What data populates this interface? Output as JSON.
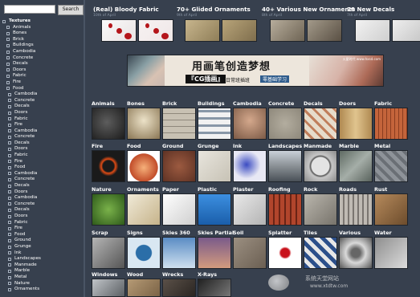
{
  "search": {
    "value": "",
    "button_label": "Search"
  },
  "tree": [
    {
      "label": "Textures",
      "level": 0,
      "root": true
    },
    {
      "label": "Animals",
      "level": 1
    },
    {
      "label": "Bones",
      "level": 1
    },
    {
      "label": "Brick",
      "level": 1
    },
    {
      "label": "Buildings",
      "level": 1
    },
    {
      "label": "Cambodia",
      "level": 1
    },
    {
      "label": "Concrete",
      "level": 1
    },
    {
      "label": "Decals",
      "level": 1
    },
    {
      "label": "Doors",
      "level": 1
    },
    {
      "label": "Fabric",
      "level": 1
    },
    {
      "label": "Fire",
      "level": 1
    },
    {
      "label": "Food",
      "level": 1
    },
    {
      "label": "Cambodia",
      "level": 2
    },
    {
      "label": "Concrete",
      "level": 2
    },
    {
      "label": "Decals",
      "level": 2
    },
    {
      "label": "Doors",
      "level": 2
    },
    {
      "label": "Fabric",
      "level": 2
    },
    {
      "label": "Fire",
      "level": 2
    },
    {
      "label": "Cambodia",
      "level": 2
    },
    {
      "label": "Concrete",
      "level": 2
    },
    {
      "label": "Decals",
      "level": 2
    },
    {
      "label": "Doors",
      "level": 2
    },
    {
      "label": "Fabric",
      "level": 2
    },
    {
      "label": "Fire",
      "level": 2
    },
    {
      "label": "Food",
      "level": 2
    },
    {
      "label": "Cambodia",
      "level": 2
    },
    {
      "label": "Concrete",
      "level": 2
    },
    {
      "label": "Decals",
      "level": 2
    },
    {
      "label": "Doors",
      "level": 2
    },
    {
      "label": "Cambodia",
      "level": 2
    },
    {
      "label": "Concrete",
      "level": 2
    },
    {
      "label": "Decals",
      "level": 2
    },
    {
      "label": "Doors",
      "level": 2
    },
    {
      "label": "Fabric",
      "level": 2
    },
    {
      "label": "Fire",
      "level": 2
    },
    {
      "label": "Food",
      "level": 2
    },
    {
      "label": "Ground",
      "level": 2
    },
    {
      "label": "Grunge",
      "level": 2
    },
    {
      "label": "Ink",
      "level": 2
    },
    {
      "label": "Landscapes",
      "level": 2
    },
    {
      "label": "Manmade",
      "level": 2
    },
    {
      "label": "Marble",
      "level": 2
    },
    {
      "label": "Metal",
      "level": 2
    },
    {
      "label": "Nature",
      "level": 2
    },
    {
      "label": "Ornaments",
      "level": 2
    }
  ],
  "top_cards": [
    {
      "title": "(Real) Bloody Fabric",
      "date": "10th of April"
    },
    {
      "title": "70+ Glided Ornaments",
      "date": "9th of April"
    },
    {
      "title": "40+ Various New Ornaments",
      "date": "8th of April"
    },
    {
      "title": "20 New Decals",
      "date": "7th of April"
    }
  ],
  "banner": {
    "title": "用画笔创造梦想",
    "brand": "『CG插画』",
    "tagline": "日常班插班",
    "button": "零基础学习",
    "corner_text": "火星时代 www.hxsd.com"
  },
  "categories": [
    {
      "label": "Animals"
    },
    {
      "label": "Bones"
    },
    {
      "label": "Brick"
    },
    {
      "label": "Buildings"
    },
    {
      "label": "Cambodia"
    },
    {
      "label": "Concrete"
    },
    {
      "label": "Decals"
    },
    {
      "label": "Doors"
    },
    {
      "label": "Fabric"
    },
    {
      "label": "Fire"
    },
    {
      "label": "Food"
    },
    {
      "label": "Ground"
    },
    {
      "label": "Grunge"
    },
    {
      "label": "Ink"
    },
    {
      "label": "Landscapes"
    },
    {
      "label": "Manmade"
    },
    {
      "label": "Marble"
    },
    {
      "label": "Metal"
    },
    {
      "label": "Nature"
    },
    {
      "label": "Ornaments"
    },
    {
      "label": "Paper"
    },
    {
      "label": "Plastic"
    },
    {
      "label": "Plaster"
    },
    {
      "label": "Roofing"
    },
    {
      "label": "Rock"
    },
    {
      "label": "Roads"
    },
    {
      "label": "Rust"
    },
    {
      "label": "Scrap"
    },
    {
      "label": "Signs"
    },
    {
      "label": "Skies 360"
    },
    {
      "label": "Skies Partial"
    },
    {
      "label": "Soil"
    },
    {
      "label": "Splatter"
    },
    {
      "label": "Tiles"
    },
    {
      "label": "Various"
    },
    {
      "label": "Water"
    },
    {
      "label": "Windows"
    },
    {
      "label": "Wood"
    },
    {
      "label": "Wrecks"
    },
    {
      "label": "X-Rays"
    }
  ],
  "watermark": {
    "text": "系统天堂网站",
    "url": "www.xtdtw.com"
  }
}
